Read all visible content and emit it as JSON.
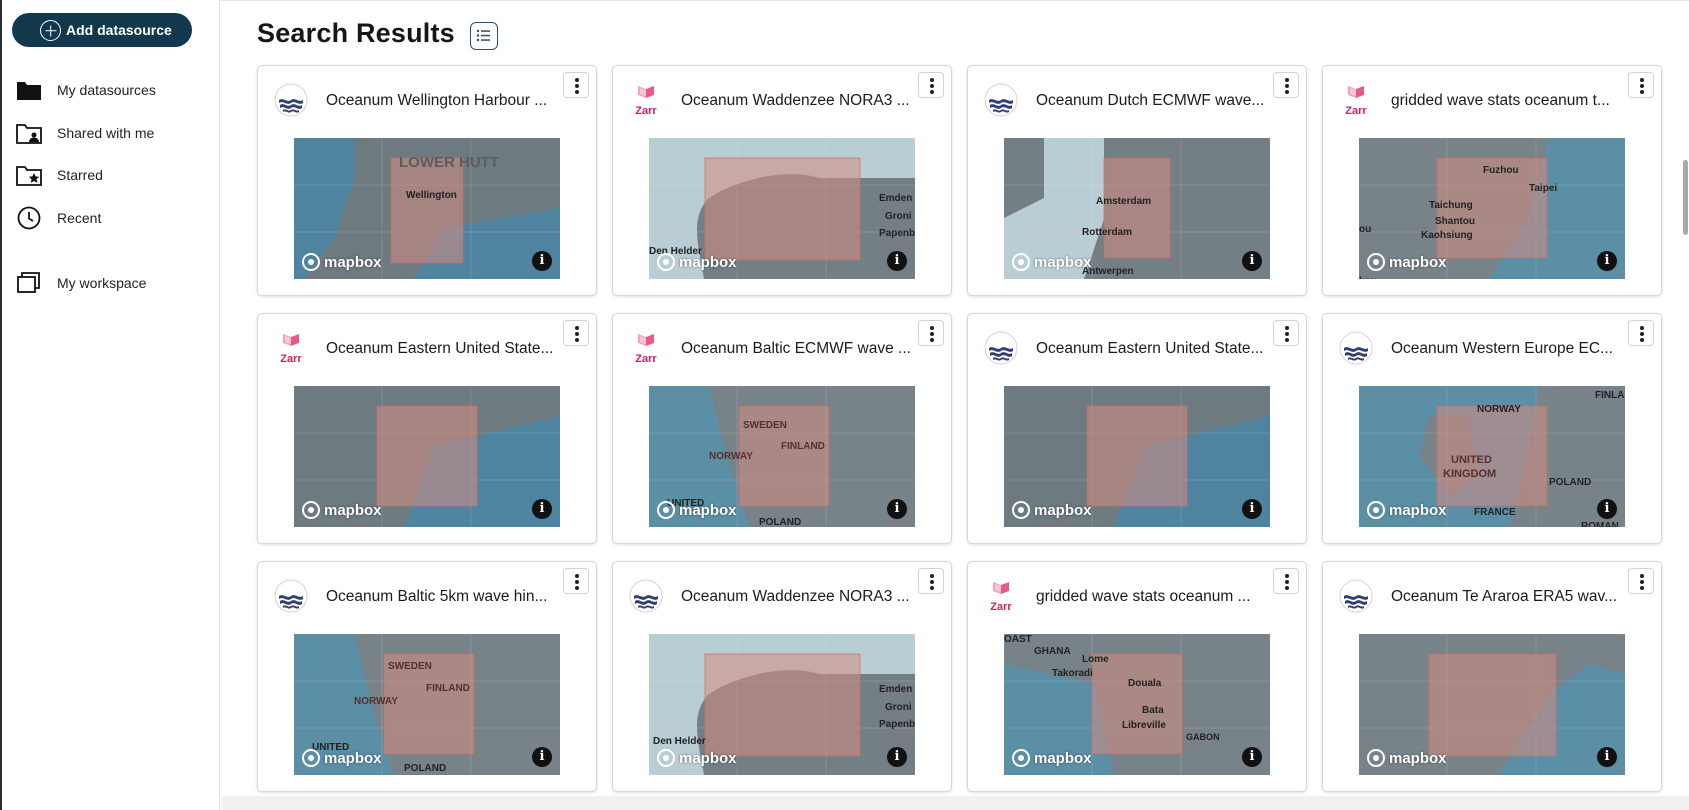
{
  "sidebar": {
    "add_button": "Add datasource",
    "items": [
      {
        "label": "My datasources",
        "icon": "folder-icon"
      },
      {
        "label": "Shared with me",
        "icon": "shared-folder-icon"
      },
      {
        "label": "Starred",
        "icon": "starred-folder-icon"
      },
      {
        "label": "Recent",
        "icon": "clock-icon"
      },
      {
        "label": "My workspace",
        "icon": "workspace-icon"
      }
    ]
  },
  "main": {
    "title": "Search Results",
    "cards": [
      {
        "name": "Oceanum Wellington Harbour ...",
        "logo": "oceanum",
        "map_labels": [
          "LOWER HUTT",
          "Wellington"
        ]
      },
      {
        "name": "Oceanum Waddenzee NORA3 ...",
        "logo": "zarr",
        "map_labels": [
          "Den Helder",
          "Emden",
          "Groni",
          "Papenbu"
        ]
      },
      {
        "name": "Oceanum Dutch ECMWF wave...",
        "logo": "oceanum",
        "map_labels": [
          "Amsterdam",
          "Rotterdam",
          "Antwerpen"
        ]
      },
      {
        "name": "gridded wave stats oceanum t...",
        "logo": "zarr",
        "map_labels": [
          "Fuzhou",
          "Taipei",
          "Taichung",
          "Shantou",
          "Kaohsiung",
          "ou",
          "kou"
        ]
      },
      {
        "name": "Oceanum Eastern United State...",
        "logo": "zarr",
        "map_labels": []
      },
      {
        "name": "Oceanum Baltic ECMWF wave ...",
        "logo": "zarr",
        "map_labels": [
          "SWEDEN",
          "FINLAND",
          "NORWAY",
          "UNITED",
          "POLAND"
        ]
      },
      {
        "name": "Oceanum Eastern United State...",
        "logo": "oceanum",
        "map_labels": []
      },
      {
        "name": "Oceanum Western Europe EC...",
        "logo": "oceanum",
        "map_labels": [
          "NORWAY",
          "UNITED KINGDOM",
          "POLAND",
          "FRANCE",
          "ROMAN",
          "FINLAN"
        ]
      },
      {
        "name": "Oceanum Baltic 5km wave hin...",
        "logo": "oceanum",
        "map_labels": [
          "SWEDEN",
          "FINLAND",
          "NORWAY",
          "UNITED",
          "POLAND"
        ]
      },
      {
        "name": "Oceanum Waddenzee NORA3 ...",
        "logo": "oceanum",
        "map_labels": [
          "Den Helder",
          "Emden",
          "Groni",
          "Papenbu"
        ]
      },
      {
        "name": "gridded wave stats oceanum ...",
        "logo": "zarr",
        "map_labels": [
          "GHANA",
          "Lome",
          "Takoradi",
          "Douala",
          "Bata",
          "Libreville",
          "GABON",
          "OAST"
        ]
      },
      {
        "name": "Oceanum Te Araroa ERA5 wav...",
        "logo": "oceanum",
        "map_labels": []
      }
    ],
    "mapbox_label": "mapbox",
    "zarr_label": "Zarr",
    "info_glyph": "i"
  },
  "colors": {
    "accent": "#12384d",
    "map_water": "#5b8fa6",
    "map_land": "#6f7c82",
    "bbox": "#c98a84"
  }
}
